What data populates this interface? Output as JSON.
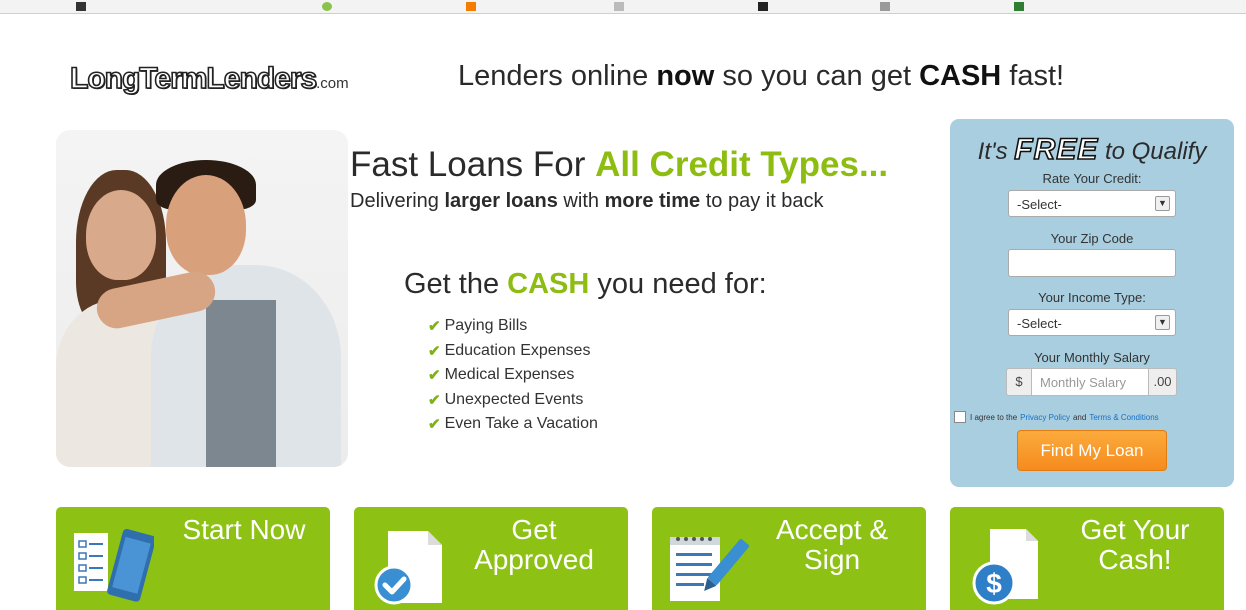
{
  "logo": {
    "name": "LongTermLenders",
    "suffix": ".com"
  },
  "tagline": {
    "pre": "Lenders online ",
    "strong1": "now",
    "mid": " so you can get ",
    "strong2": "CASH",
    "post": " fast!"
  },
  "headline": {
    "pre": "Fast Loans For ",
    "highlight": "All Credit Types..."
  },
  "subhead": {
    "pre": "Delivering ",
    "strong1": "larger loans",
    "mid": " with ",
    "strong2": "more time",
    "post": " to pay it back"
  },
  "cash_heading": {
    "pre": "Get the ",
    "highlight": "CASH",
    "post": " you need for:"
  },
  "reasons": [
    "Paying Bills",
    "Education Expenses",
    "Medical Expenses",
    "Unexpected Events",
    "Even Take a Vacation"
  ],
  "form": {
    "title_pre": "It's ",
    "title_free": "FREE",
    "title_post": " to Qualify",
    "credit_label": "Rate Your Credit:",
    "credit_value": "-Select-",
    "zip_label": "Your Zip Code",
    "zip_value": "",
    "income_label": "Your Income Type:",
    "income_value": "-Select-",
    "salary_label": "Your Monthly Salary",
    "salary_prefix": "$",
    "salary_placeholder": "Monthly Salary",
    "salary_suffix": ".00",
    "agree_pre": "I agree to the",
    "privacy_link": "Privacy Policy",
    "agree_and": "and",
    "terms_link": "Terms & Conditions",
    "submit_label": "Find My Loan"
  },
  "steps": [
    {
      "line1": "Start Now",
      "line2": "",
      "icon": "phone-checklist-icon"
    },
    {
      "line1": "Get",
      "line2": "Approved",
      "icon": "document-checkmark-icon"
    },
    {
      "line1": "Accept &",
      "line2": "Sign",
      "icon": "notepad-pen-icon"
    },
    {
      "line1": "Get Your",
      "line2": "Cash!",
      "icon": "dollar-document-icon"
    }
  ],
  "colors": {
    "brand_green": "#8dc215",
    "headline_green": "#8dbd11",
    "form_bg": "#a8cedf",
    "button_orange": "#f68b1e"
  }
}
